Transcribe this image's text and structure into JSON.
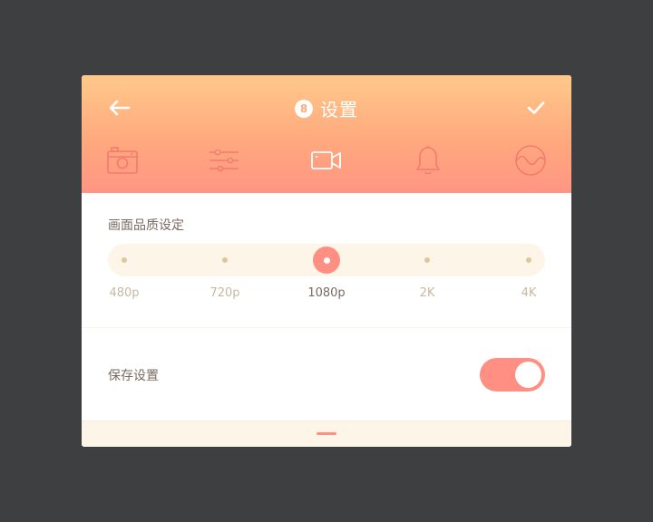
{
  "header": {
    "title": "设置",
    "badge": "8",
    "back_icon": "arrow-left-icon",
    "confirm_icon": "check-icon",
    "gradient_top": "#ffc98a",
    "gradient_bottom": "#ff9583"
  },
  "tabs": [
    {
      "id": "camera",
      "icon": "camera-icon"
    },
    {
      "id": "adjust",
      "icon": "sliders-icon"
    },
    {
      "id": "video",
      "icon": "video-camera-icon",
      "selected": true
    },
    {
      "id": "notifications",
      "icon": "bell-icon"
    },
    {
      "id": "wave",
      "icon": "wave-circle-icon"
    }
  ],
  "quality": {
    "title": "画面品质设定",
    "options": [
      "480p",
      "720p",
      "1080p",
      "2K",
      "4K"
    ],
    "selected": "1080p",
    "selected_index": 2
  },
  "save": {
    "label": "保存设置",
    "enabled": true
  },
  "colors": {
    "accent": "#ff8f83",
    "track": "#fdf6e8",
    "dot": "#ddc89b",
    "text_dark": "#7a6a62",
    "text_light": "#c8b8a0"
  }
}
